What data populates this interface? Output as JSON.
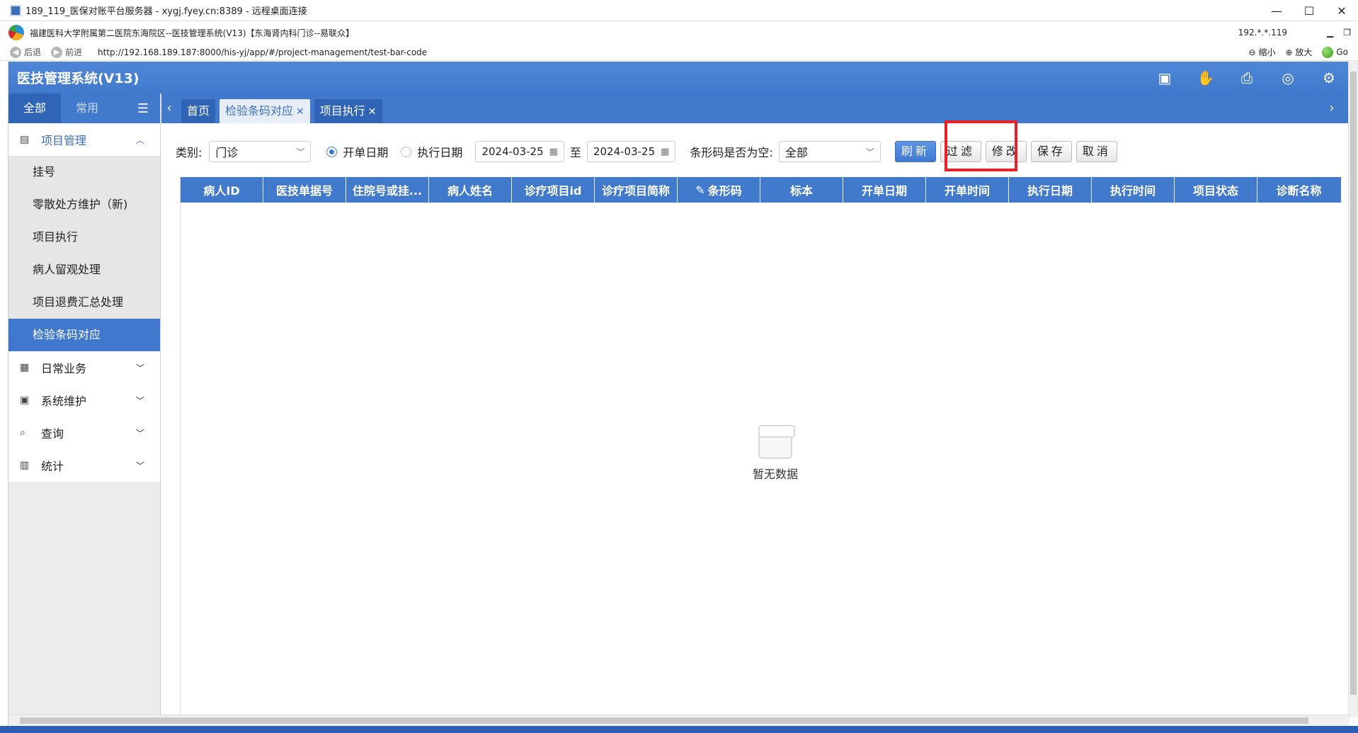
{
  "rdp": {
    "title": "189_119_医保对账平台服务器 - xygj.fyey.cn:8389 - 远程桌面连接",
    "minimize": "—",
    "maximize": "☐",
    "close": "✕"
  },
  "browser": {
    "title": "福建医科大学附属第二医院东海院区--医技管理系统(V13)【东海肾内科门诊--易联众】",
    "ip": "192.*.*.119",
    "back": "后退",
    "forward": "前进",
    "url": "http://192.168.189.187:8000/his-yj/app/#/project-management/test-bar-code",
    "zoom_out": "缩小",
    "zoom_in": "放大",
    "go": "Go"
  },
  "app": {
    "title": "医技管理系统(V13)"
  },
  "sidebar": {
    "tabs": [
      "全部",
      "常用"
    ],
    "groups": [
      {
        "label": "项目管理",
        "icon": "document-icon",
        "expanded": true,
        "items": [
          "挂号",
          "零散处方维护（新)",
          "项目执行",
          "病人留观处理",
          "项目退费汇总处理",
          "检验条码对应"
        ],
        "active_item": "检验条码对应"
      },
      {
        "label": "日常业务",
        "icon": "calendar-icon",
        "expanded": false
      },
      {
        "label": "系统维护",
        "icon": "monitor-icon",
        "expanded": false
      },
      {
        "label": "查询",
        "icon": "search-icon",
        "expanded": false
      },
      {
        "label": "统计",
        "icon": "chart-icon",
        "expanded": false
      }
    ]
  },
  "tabs": [
    {
      "label": "首页",
      "closable": false,
      "active": false
    },
    {
      "label": "检验条码对应",
      "closable": true,
      "active": true
    },
    {
      "label": "项目执行",
      "closable": true,
      "active": false
    }
  ],
  "toolbar": {
    "category_label": "类别:",
    "category_value": "门诊",
    "radio_open_date": "开单日期",
    "radio_exec_date": "执行日期",
    "date_from": "2024-03-25",
    "to_label": "至",
    "date_to": "2024-03-25",
    "barcode_empty_label": "条形码是否为空:",
    "barcode_empty_value": "全部",
    "refresh": "刷新",
    "filter": "过滤",
    "modify": "修改",
    "save": "保存",
    "cancel": "取消"
  },
  "grid": {
    "columns": [
      "病人ID",
      "医技单据号",
      "住院号或挂...",
      "病人姓名",
      "诊疗项目id",
      "诊疗项目简称",
      "条形码",
      "标本",
      "开单日期",
      "开单时间",
      "执行日期",
      "执行时间",
      "项目状态",
      "诊断名称"
    ],
    "rows": [],
    "empty_text": "暂无数据"
  },
  "colors": {
    "primary": "#4179cc",
    "highlight": "#e8202a"
  }
}
